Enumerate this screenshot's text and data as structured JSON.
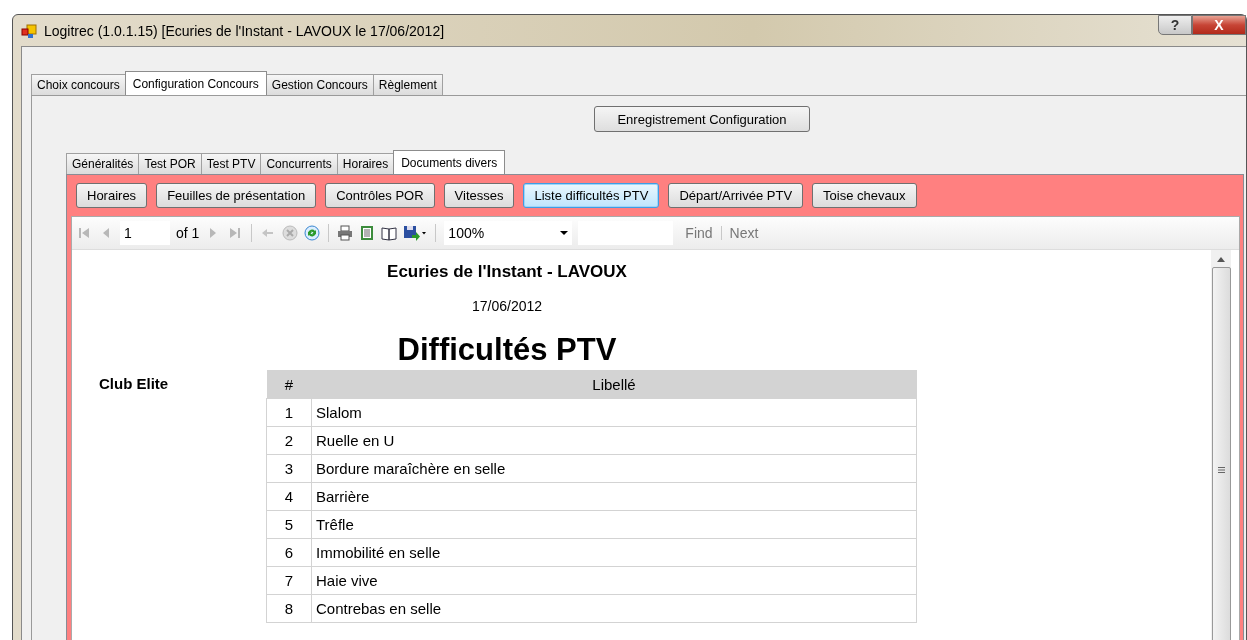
{
  "window": {
    "title": "Logitrec (1.0.1.15) [Ecuries de l'Instant - LAVOUX le 17/06/2012]",
    "help_button": "?",
    "close_button": "X"
  },
  "main_tabs": [
    {
      "label": "Choix concours",
      "selected": false
    },
    {
      "label": "Configuration Concours",
      "selected": true
    },
    {
      "label": "Gestion Concours",
      "selected": false
    },
    {
      "label": "Règlement",
      "selected": false
    }
  ],
  "save_button": "Enregistrement Configuration",
  "sub_tabs": [
    {
      "label": "Généralités",
      "selected": false
    },
    {
      "label": "Test POR",
      "selected": false
    },
    {
      "label": "Test PTV",
      "selected": false
    },
    {
      "label": "Concurrents",
      "selected": false
    },
    {
      "label": "Horaires",
      "selected": false
    },
    {
      "label": "Documents divers",
      "selected": true
    }
  ],
  "document_buttons": [
    {
      "label": "Horaires",
      "selected": false
    },
    {
      "label": "Feuilles de présentation",
      "selected": false
    },
    {
      "label": "Contrôles POR",
      "selected": false
    },
    {
      "label": "Vitesses",
      "selected": false
    },
    {
      "label": "Liste difficultés PTV",
      "selected": true
    },
    {
      "label": "Départ/Arrivée PTV",
      "selected": false
    },
    {
      "label": "Toise chevaux",
      "selected": false
    }
  ],
  "report_toolbar": {
    "page": "1",
    "page_count": "of 1",
    "zoom": "100%",
    "find": "Find",
    "next": "Next"
  },
  "report": {
    "title": "Ecuries de l'Instant - LAVOUX",
    "date": "17/06/2012",
    "heading": "Difficultés PTV",
    "group": "Club Elite",
    "columns": [
      "#",
      "Libellé"
    ],
    "rows": [
      [
        "1",
        "Slalom"
      ],
      [
        "2",
        "Ruelle en U"
      ],
      [
        "3",
        "Bordure maraîchère en selle"
      ],
      [
        "4",
        "Barrière"
      ],
      [
        "5",
        "Trêfle"
      ],
      [
        "6",
        "Immobilité en selle"
      ],
      [
        "7",
        "Haie vive"
      ],
      [
        "8",
        "Contrebas en selle"
      ]
    ]
  }
}
